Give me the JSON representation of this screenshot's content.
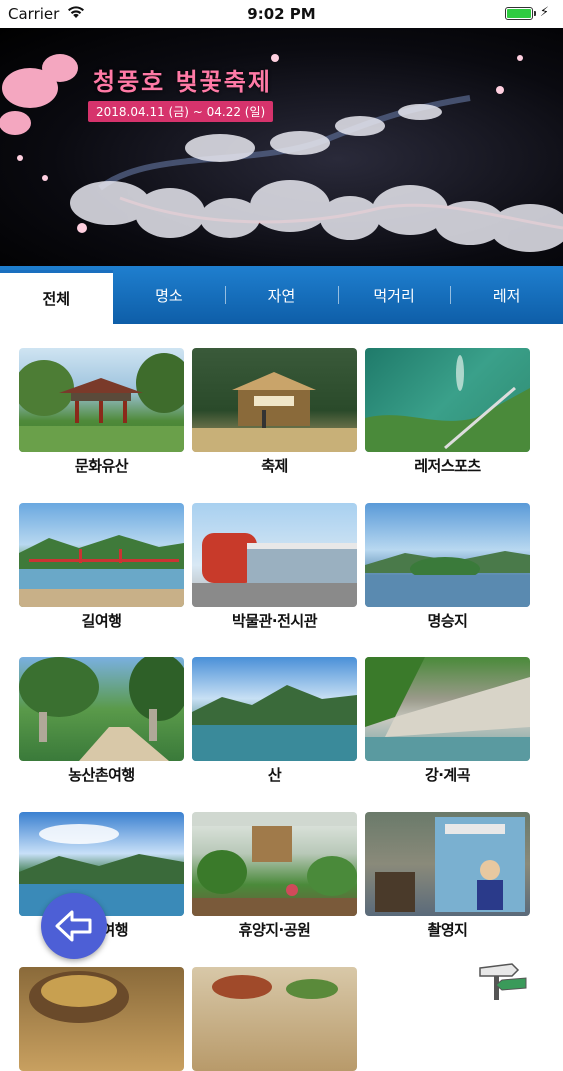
{
  "status_bar": {
    "carrier": "Carrier",
    "time": "9:02 PM",
    "battery_level": 1.0
  },
  "banner": {
    "title": "청풍호 벚꽃축제",
    "dates": "2018.04.11 (금) ~ 04.22 (일)"
  },
  "tabs": [
    {
      "label": "전체",
      "active": true
    },
    {
      "label": "명소",
      "active": false
    },
    {
      "label": "자연",
      "active": false
    },
    {
      "label": "먹거리",
      "active": false
    },
    {
      "label": "레저",
      "active": false
    }
  ],
  "categories": [
    {
      "label": "문화유산"
    },
    {
      "label": "축제"
    },
    {
      "label": "레저스포츠"
    },
    {
      "label": "길여행"
    },
    {
      "label": "박물관·전시관"
    },
    {
      "label": "명승지"
    },
    {
      "label": "농산촌여행"
    },
    {
      "label": "산"
    },
    {
      "label": "강·계곡"
    },
    {
      "label": "호수여행"
    },
    {
      "label": "휴양지·공원"
    },
    {
      "label": "촬영지"
    }
  ],
  "colors": {
    "tab_bar": "#1a6fbf",
    "fab": "#4d5fd6",
    "banner_title": "#ff7aa6"
  },
  "icons": {
    "fab": "back-arrow-icon",
    "corner": "signpost-icon"
  }
}
